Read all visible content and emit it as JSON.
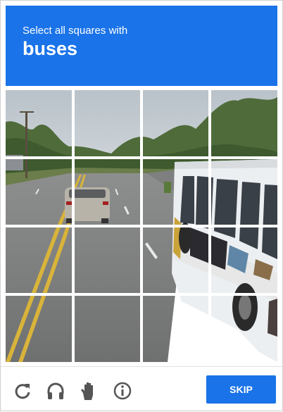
{
  "header": {
    "instruction": "Select all squares with",
    "target": "buses"
  },
  "colors": {
    "accent": "#1a73e8",
    "icon_gray": "#555555"
  },
  "grid": {
    "rows": 4,
    "cols": 4,
    "tiles": [
      {
        "id": "r1c1"
      },
      {
        "id": "r1c2"
      },
      {
        "id": "r1c3"
      },
      {
        "id": "r1c4"
      },
      {
        "id": "r2c1"
      },
      {
        "id": "r2c2"
      },
      {
        "id": "r2c3"
      },
      {
        "id": "r2c4"
      },
      {
        "id": "r3c1"
      },
      {
        "id": "r3c2"
      },
      {
        "id": "r3c3"
      },
      {
        "id": "r3c4"
      },
      {
        "id": "r4c1"
      },
      {
        "id": "r4c2"
      },
      {
        "id": "r4c3"
      },
      {
        "id": "r4c4"
      }
    ]
  },
  "footer": {
    "icons": [
      "reload-icon",
      "audio-icon",
      "hand-icon",
      "info-icon"
    ],
    "skip_label": "SKIP"
  }
}
